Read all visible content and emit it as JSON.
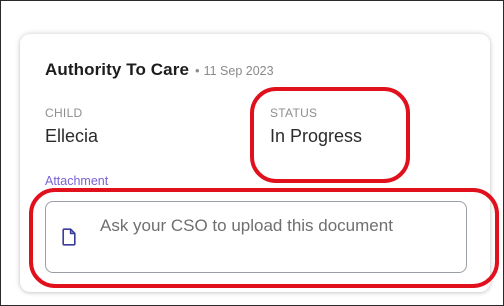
{
  "card": {
    "title": "Authority To Care",
    "separator": "•",
    "date": "11 Sep 2023",
    "child": {
      "label": "CHILD",
      "value": "Ellecia"
    },
    "status": {
      "label": "STATUS",
      "value": "In Progress"
    },
    "attachment": {
      "label": "Attachment",
      "message": "Ask your CSO to upload this document",
      "icon": "document-icon"
    }
  },
  "colors": {
    "accent_label": "#7b62d6",
    "annotation": "#e0101c"
  }
}
